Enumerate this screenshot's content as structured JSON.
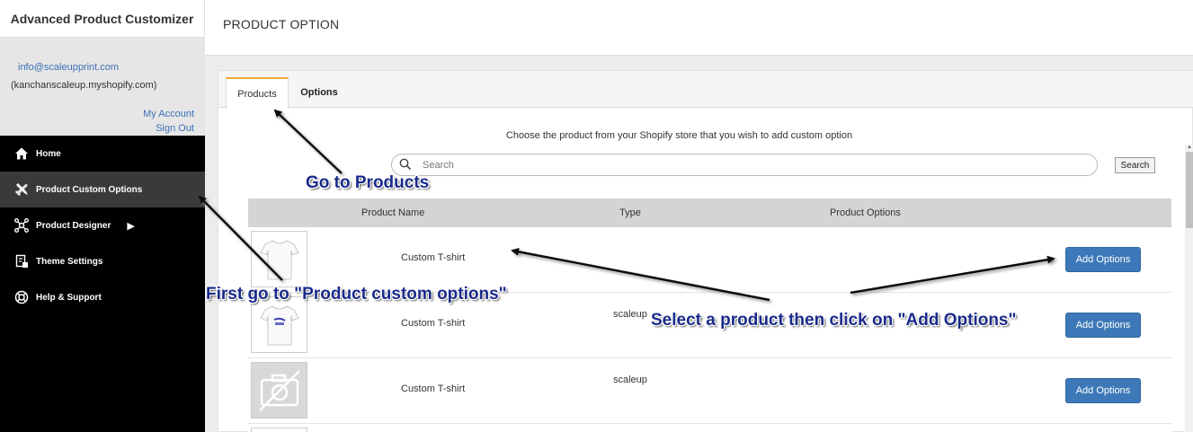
{
  "app": {
    "title": "Advanced Product Customizer",
    "email": "info@scaleupprint.com",
    "shop": "(kanchanscaleup.myshopify.com)",
    "my_account": "My Account",
    "sign_out": "Sign Out"
  },
  "sidebar": {
    "items": [
      {
        "label": "Home",
        "icon": "home-icon"
      },
      {
        "label": "Product Custom Options",
        "icon": "tools-icon",
        "active": true
      },
      {
        "label": "Product Designer",
        "icon": "network-icon",
        "has_submenu": true
      },
      {
        "label": "Theme Settings",
        "icon": "theme-icon"
      },
      {
        "label": "Help & Support",
        "icon": "lifebuoy-icon"
      }
    ]
  },
  "header": {
    "title": "PRODUCT OPTION"
  },
  "tabs": [
    {
      "label": "Products",
      "active": true
    },
    {
      "label": "Options"
    }
  ],
  "main": {
    "intro": "Choose the product from your Shopify store that you wish to add custom option",
    "search": {
      "placeholder": "Search",
      "button": "Search"
    }
  },
  "table": {
    "headers": [
      "Product Name",
      "Type",
      "Product Options"
    ],
    "rows": [
      {
        "name": "Custom T-shirt",
        "type": "",
        "button": "Add Options",
        "thumb": "white-tshirt"
      },
      {
        "name": "Custom T-shirt",
        "type": "scaleup",
        "button": "Add Options",
        "thumb": "printed-tshirt"
      },
      {
        "name": "Custom T-shirt",
        "type": "scaleup",
        "button": "Add Options",
        "thumb": "placeholder-camera"
      }
    ]
  },
  "annotations": {
    "go_products": "Go to Products",
    "first_go": "First go to \"Product custom options\"",
    "select_product": "Select a product then click on \"Add Options\""
  },
  "colors": {
    "sidebar_bg": "#000000",
    "active_item": "#3a3a3a",
    "link": "#3b6fb6",
    "button": "#3d79b8",
    "tab_accent": "#f0a830",
    "annotation": "#1a2a8a"
  }
}
